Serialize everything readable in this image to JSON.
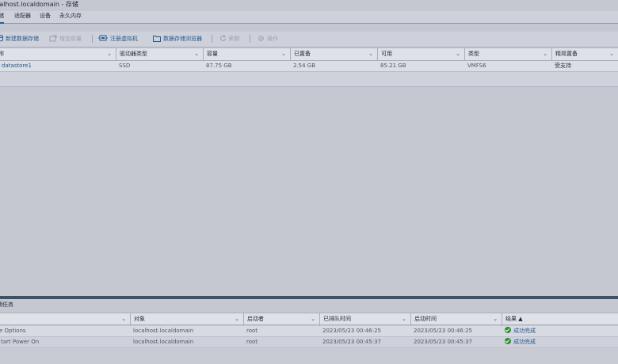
{
  "window": {
    "title": "calhost.localdomain - 存储"
  },
  "tabs": [
    "储",
    "适配器",
    "设备",
    "永久内存"
  ],
  "toolbar": {
    "new_datastore": "新建数据存储",
    "increase_capacity": "增加容量",
    "register_vm": "注册虚拟机",
    "datastore_browser": "数据存储浏览器",
    "refresh": "刷新",
    "actions": "操作"
  },
  "datastores": {
    "columns": [
      "称",
      "驱动器类型",
      "容量",
      "已置备",
      "可用",
      "类型",
      "精简置备"
    ],
    "rows": [
      {
        "name": "datastore1",
        "drive_type": "SSD",
        "capacity": "87.75 GB",
        "provisioned": "2.54 GB",
        "free": "85.21 GB",
        "type": "VMFS6",
        "thin": "受支持"
      }
    ]
  },
  "tasks": {
    "title": "期任务",
    "columns": [
      "",
      "对象",
      "启动者",
      "已排队时间",
      "启动时间",
      "结果 ▲"
    ],
    "rows": [
      {
        "task": "e Options",
        "target": "localhost.localdomain",
        "initiator": "root",
        "queued": "2023/05/23 00:46:25",
        "started": "2023/05/23 00:46:25",
        "result": "成功完成"
      },
      {
        "task": "tart Power On",
        "target": "localhost.localdomain",
        "initiator": "root",
        "queued": "2023/05/23 00:45:37",
        "started": "2023/05/23 00:45:37",
        "result": "成功完成"
      }
    ]
  },
  "colors": {
    "accent": "#1f5a92",
    "success": "#2f8f2f",
    "divider": "#3d5266"
  }
}
